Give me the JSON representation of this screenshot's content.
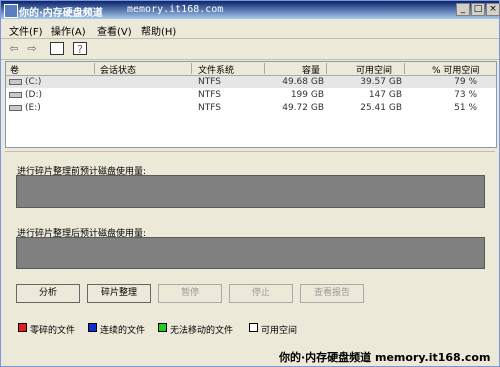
{
  "window": {
    "title": "你的·内存硬盘频道",
    "title_watermark": "memory.it168.com"
  },
  "menu": [
    "文件(F)",
    "操作(A)",
    "查看(V)",
    "帮助(H)"
  ],
  "table": {
    "columns": [
      "卷",
      "会话状态",
      "文件系统",
      "容量",
      "可用空间",
      "% 可用空间"
    ],
    "rows": [
      {
        "vol": "(C:)",
        "state": "",
        "fs": "NTFS",
        "cap": "49.68 GB",
        "free": "39.57 GB",
        "pct": "79 %"
      },
      {
        "vol": "(D:)",
        "state": "",
        "fs": "NTFS",
        "cap": "199 GB",
        "free": "147 GB",
        "pct": "73 %"
      },
      {
        "vol": "(E:)",
        "state": "",
        "fs": "NTFS",
        "cap": "49.72 GB",
        "free": "25.41 GB",
        "pct": "51 %"
      }
    ]
  },
  "labels": {
    "before": "进行碎片整理前预计磁盘使用量:",
    "after": "进行碎片整理后预计磁盘使用量:"
  },
  "buttons": {
    "analyze": "分析",
    "defrag": "碎片整理",
    "pause": "暂停",
    "stop": "停止",
    "report": "查看报告"
  },
  "legend": [
    {
      "label": "零碎的文件",
      "color": "#E02020"
    },
    {
      "label": "连续的文件",
      "color": "#1030D0"
    },
    {
      "label": "无法移动的文件",
      "color": "#20D020"
    },
    {
      "label": "可用空间",
      "color": "#FFFFFF"
    }
  ],
  "watermark": "你的·内存硬盘频道  memory.it168.com"
}
